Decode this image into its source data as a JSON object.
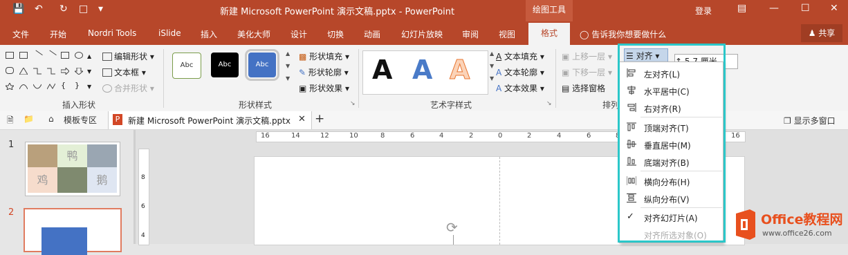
{
  "window": {
    "title": "新建 Microsoft PowerPoint 演示文稿.pptx  -  PowerPoint",
    "context_tab": "绘图工具",
    "login": "登录"
  },
  "ribbon_tabs": [
    "文件",
    "开始",
    "Nordri Tools",
    "iSlide",
    "插入",
    "美化大师",
    "设计",
    "切换",
    "动画",
    "幻灯片放映",
    "审阅",
    "视图"
  ],
  "active_tab": "格式",
  "tell_me": "告诉我你想要做什么",
  "share": "共享",
  "groups": {
    "insert_shapes": {
      "label": "插入形状",
      "edit_shape": "编辑形状",
      "text_box": "文本框",
      "merge_shapes": "合并形状"
    },
    "shape_styles": {
      "label": "形状样式",
      "preset_label": "Abc",
      "fill": "形状填充",
      "outline": "形状轮廓",
      "effects": "形状效果"
    },
    "wordart": {
      "label": "艺术字样式",
      "letter": "A",
      "text_fill": "文本填充",
      "text_outline": "文本轮廓",
      "text_effects": "文本效果"
    },
    "arrange": {
      "label": "排列",
      "bring_forward": "上移一层",
      "send_backward": "下移一层",
      "selection_pane": "选择窗格",
      "align": "对齐"
    },
    "size": {
      "height": "5.7 厘米"
    }
  },
  "doc_tabs": {
    "template": "模板专区",
    "document": "新建 Microsoft PowerPoint 演示文稿.pptx",
    "multi_window": "显示多窗口"
  },
  "ruler_labels": [
    "16",
    "14",
    "12",
    "10",
    "8",
    "6",
    "4",
    "2",
    "0",
    "2",
    "4",
    "6",
    "8",
    "10",
    "12",
    "14",
    "16"
  ],
  "vruler_labels": [
    "8",
    "6",
    "4"
  ],
  "slides": {
    "numbers": [
      "1",
      "2"
    ],
    "thumb_labels": [
      "鸭",
      "鸡",
      "鹅"
    ]
  },
  "align_menu": {
    "items": [
      {
        "label": "左对齐(L)",
        "icon": "align-left-icon"
      },
      {
        "label": "水平居中(C)",
        "icon": "align-center-icon"
      },
      {
        "label": "右对齐(R)",
        "icon": "align-right-icon"
      },
      {
        "label": "顶端对齐(T)",
        "icon": "align-top-icon"
      },
      {
        "label": "垂直居中(M)",
        "icon": "align-middle-icon"
      },
      {
        "label": "底端对齐(B)",
        "icon": "align-bottom-icon"
      },
      {
        "label": "横向分布(H)",
        "icon": "distribute-horizontal-icon"
      },
      {
        "label": "纵向分布(V)",
        "icon": "distribute-vertical-icon"
      },
      {
        "label": "对齐幻灯片(A)",
        "icon": "check-icon",
        "checked": true
      },
      {
        "label": "对齐所选对象(O)",
        "icon": "",
        "disabled": true
      }
    ]
  },
  "logo": {
    "text": "Office教程网",
    "url": "www.office26.com"
  },
  "colors": {
    "brand": "#b7472a",
    "highlight": "#2bc7c9",
    "logo_orange": "#e8501e"
  }
}
